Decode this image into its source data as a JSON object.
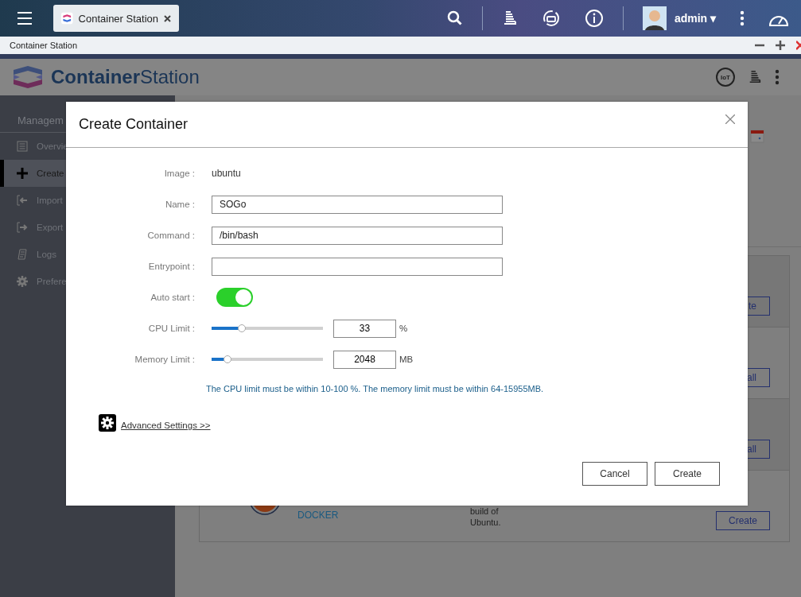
{
  "topbar": {
    "tab": {
      "label": "Container Station",
      "selected": true
    },
    "user": "admin",
    "caret": "▾"
  },
  "window": {
    "title": "Container Station"
  },
  "app": {
    "logo_bold": "Container",
    "logo_light": "Station",
    "iot": "IoT"
  },
  "sidebar": {
    "heading": "Managem",
    "items": [
      {
        "label": "Overvie",
        "selected": false
      },
      {
        "label": "Create",
        "selected": true
      },
      {
        "label": "Import",
        "selected": false
      },
      {
        "label": "Export",
        "selected": false
      },
      {
        "label": "Logs",
        "selected": false
      },
      {
        "label": "Prefere",
        "selected": false
      }
    ]
  },
  "cards": [
    {
      "button": "te"
    },
    {
      "button": "all"
    },
    {
      "button": "all"
    },
    {
      "button": "Create",
      "source": "DOCKER",
      "description": "build of Ubuntu."
    }
  ],
  "dialog": {
    "title": "Create Container",
    "fields": [
      {
        "kind": "text",
        "label": "Image :",
        "value": "ubuntu"
      },
      {
        "kind": "input",
        "label": "Name :",
        "value": "SOGo"
      },
      {
        "kind": "input",
        "label": "Command :",
        "value": "/bin/bash"
      },
      {
        "kind": "input",
        "label": "Entrypoint :"
      },
      {
        "kind": "toggle",
        "label": "Auto start :",
        "on": true
      },
      {
        "kind": "slider",
        "label": "CPU Limit :",
        "level": 0.27,
        "value": "33",
        "unit": "%"
      },
      {
        "kind": "slider",
        "label": "Memory Limit :",
        "level": 0.14,
        "value": "2048",
        "unit": "MB"
      }
    ],
    "note": "The CPU limit must be within 10-100 %. The memory limit must be within 64-15955MB.",
    "advanced": "Advanced Settings >>",
    "buttons": [
      "Cancel",
      "Create"
    ]
  }
}
